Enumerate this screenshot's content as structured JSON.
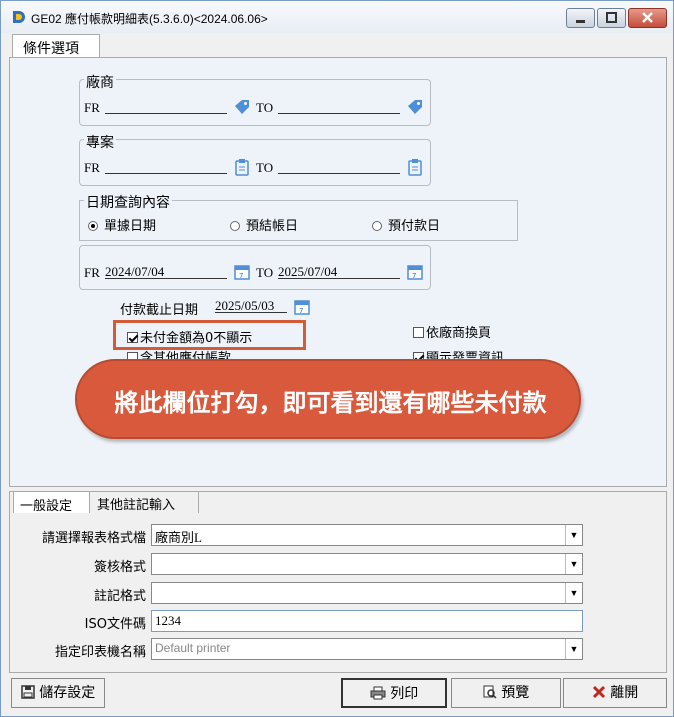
{
  "window": {
    "title": "GE02 應付帳款明細表(5.3.6.0)<2024.06.06>"
  },
  "tabs": {
    "conditions": "條件選項"
  },
  "vendor": {
    "legend": "廠商",
    "fr": "FR",
    "to": "TO",
    "from_value": "",
    "to_value": ""
  },
  "project": {
    "legend": "專案",
    "fr": "FR",
    "to": "TO",
    "from_value": "",
    "to_value": ""
  },
  "date_query": {
    "legend": "日期查詢內容",
    "options": [
      "單據日期",
      "預結帳日",
      "預付款日"
    ],
    "selected": "單據日期"
  },
  "date_range": {
    "fr": "FR",
    "to": "TO",
    "from_value": "2024/07/04",
    "to_value": "2025/07/04"
  },
  "cutoff": {
    "label": "付款截止日期",
    "value": "2025/05/03"
  },
  "checks": {
    "unpaid_zero": "未付金額為0不顯示",
    "include_other": "含其他應付帳款",
    "page_by_vendor": "依廠商換頁",
    "show_invoice": "顯示發票資訊"
  },
  "callout": "將此欄位打勾，即可看到還有哪些未付款",
  "lower_tabs": {
    "general": "一般設定",
    "other": "其他註記輸入"
  },
  "form": {
    "format_label": "請選擇報表格式檔",
    "format_value": "廠商別L",
    "sign_label": "簽核格式",
    "sign_value": "",
    "note_label": "註記格式",
    "note_value": "",
    "iso_label": "ISO文件碼",
    "iso_value": "1234",
    "printer_label": "指定印表機名稱",
    "printer_value": "Default printer"
  },
  "buttons": {
    "save": "儲存設定",
    "print": "列印",
    "preview": "預覽",
    "leave": "離開"
  },
  "colors": {
    "accent": "#d9593c",
    "panel": "#eef3f9"
  }
}
